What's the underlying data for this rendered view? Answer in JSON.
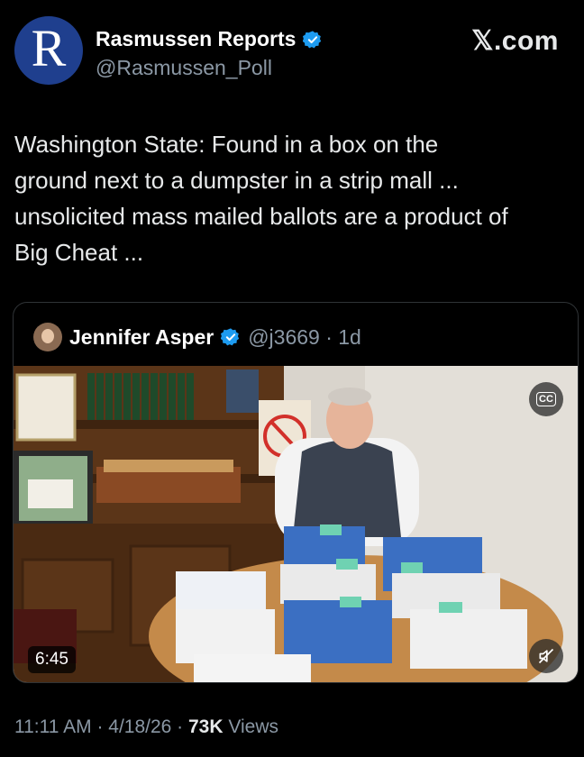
{
  "tweet": {
    "author_name": "Rasmussen Reports",
    "author_handle": "@Rasmussen_Poll",
    "avatar_letter": "R",
    "brand": "𝕏.com",
    "text": "Washington State: Found in a box on the\nground next to a dumpster in a strip mall ...\nunsolicited mass mailed ballots are a product of\nBig Cheat ...",
    "timestamp": "11:11 AM · 4/18/26 · ",
    "views_count": "73K",
    "views_label": " Views"
  },
  "quote": {
    "author_name": "Jennifer Asper",
    "author_handle": "@j3669 · 1d",
    "video_duration": "6:45",
    "cc_label": "CC"
  },
  "colors": {
    "background": "#000000",
    "text": "#e7e9ea",
    "muted": "#8b98a5",
    "verified": "#1d9bf0",
    "avatar": "#1f3f8e"
  },
  "icons": {
    "verified": "verified-badge-icon",
    "captions": "closed-captions-icon",
    "mute": "speaker-muted-icon"
  }
}
